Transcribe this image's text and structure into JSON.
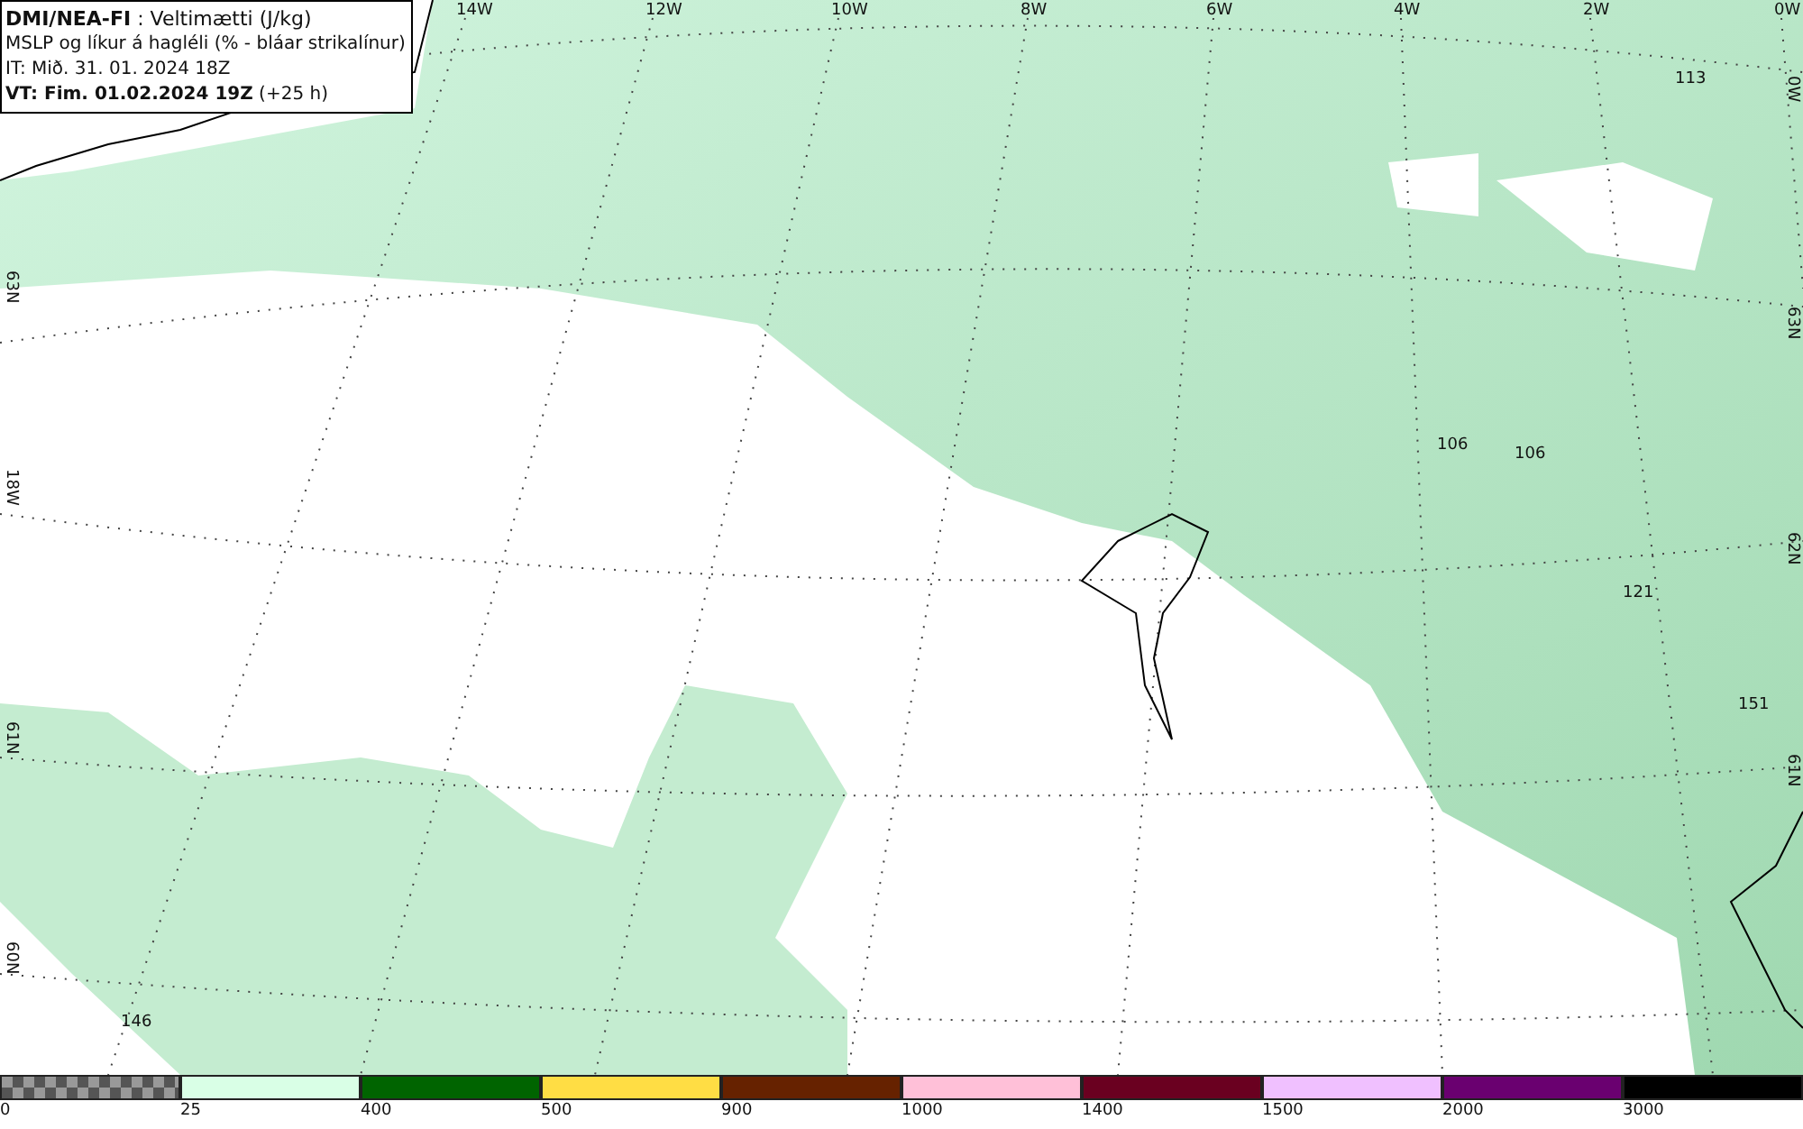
{
  "header": [
    "**DMI/NEA-FI** : Veltimætti (J/kg)",
    "MSLP og líkur á hagléli (% - bláar strikalínur)",
    "IT: Mið. 31. 01. 2024 18Z",
    "**VT: Fim. 01.02.2024 19Z** (+25 h)"
  ],
  "map": {
    "top_labels": [
      "14W",
      "12W",
      "10W",
      "8W",
      "6W",
      "4W",
      "2W",
      "0W"
    ],
    "right_labels": [
      "0W",
      "63N",
      "62N",
      "61N"
    ],
    "left_labels": [
      "63N",
      "18W",
      "61N",
      "60N"
    ],
    "values": [
      "113",
      "106",
      "106",
      "121",
      "151",
      "146"
    ]
  },
  "legend": [
    {
      "kind": "checker",
      "label": "0"
    },
    {
      "kind": "solid",
      "color": "#d9ffe6",
      "label": "25"
    },
    {
      "kind": "solid",
      "color": "#006400",
      "label": "400"
    },
    {
      "kind": "solid",
      "color": "#ffdd44",
      "label": "500"
    },
    {
      "kind": "solid",
      "color": "#662200",
      "label": "900"
    },
    {
      "kind": "solid",
      "color": "#ffc0d8",
      "label": "1000"
    },
    {
      "kind": "solid",
      "color": "#6a0020",
      "label": "1400"
    },
    {
      "kind": "solid",
      "color": "#f0c0ff",
      "label": "1500"
    },
    {
      "kind": "solid",
      "color": "#6a0070",
      "label": "2000"
    },
    {
      "kind": "solid",
      "color": "#000000",
      "label": "3000"
    }
  ]
}
